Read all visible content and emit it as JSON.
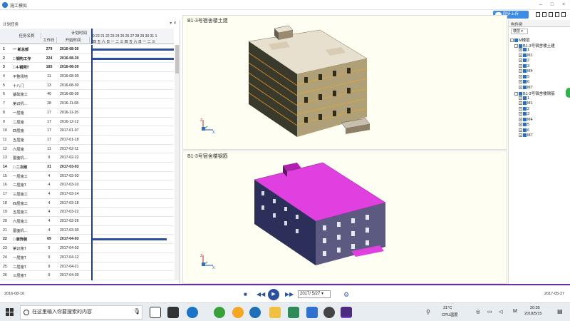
{
  "titlebar": {
    "title": "施工模拟"
  },
  "toolbar": {
    "cloud_label": "同步上传"
  },
  "plan_panel": {
    "title": "计划任务",
    "columns": {
      "name": "任务名称",
      "duration": "工作日",
      "start": "开始时间",
      "plan_group": "计划时间"
    },
    "gantt_days": "0 22 21 22 23 24 25 26 27 28 29 30 31 1",
    "gantt_weekdays": "四 五 六 日 一 二 三 四 五 六 日 一 二 三",
    "rows": [
      {
        "num": "1",
        "name": "一 新总部",
        "dur": "279",
        "date": "2016-08-30",
        "bold": true,
        "bar": 116
      },
      {
        "num": "2",
        "name": "□ 钢构工作",
        "dur": "224",
        "date": "2016-08-30",
        "bold": true,
        "bar": 116
      },
      {
        "num": "3",
        "name": "□ 4-钢网T",
        "dur": "185",
        "date": "2016-08-30",
        "bold": true,
        "bar": 0
      },
      {
        "num": "4",
        "name": "平整场地",
        "dur": "11",
        "date": "2016-08-30",
        "bold": false,
        "bar": 0
      },
      {
        "num": "5",
        "name": "十八门",
        "dur": "13",
        "date": "2016-08-30",
        "bold": false,
        "bar": 0
      },
      {
        "num": "6",
        "name": "基础施工",
        "dur": "40",
        "date": "2016-08-30",
        "bold": false,
        "bar": 0
      },
      {
        "num": "7",
        "name": "第识机…",
        "dur": "28",
        "date": "2016-11-08",
        "bold": false,
        "bar": 0
      },
      {
        "num": "8",
        "name": "一层施",
        "dur": "17",
        "date": "2016-11-25",
        "bold": false,
        "bar": 0
      },
      {
        "num": "9",
        "name": "二层施",
        "dur": "17",
        "date": "2016-12-12",
        "bold": false,
        "bar": 0
      },
      {
        "num": "10",
        "name": "四层施",
        "dur": "17",
        "date": "2017-01-07",
        "bold": false,
        "bar": 0
      },
      {
        "num": "11",
        "name": "五层施",
        "dur": "17",
        "date": "2017-01-18",
        "bold": false,
        "bar": 0
      },
      {
        "num": "12",
        "name": "六层施",
        "dur": "11",
        "date": "2017-02-11",
        "bold": false,
        "bar": 0
      },
      {
        "num": "13",
        "name": "屋面机…",
        "dur": "9",
        "date": "2017-02-22",
        "bold": false,
        "bar": 0
      },
      {
        "num": "14",
        "name": "□ 二次砌",
        "dur": "31",
        "date": "2017-03-03",
        "bold": true,
        "bar": 0
      },
      {
        "num": "15",
        "name": "一层施工",
        "dur": "4",
        "date": "2017-03-03",
        "bold": false,
        "bar": 0
      },
      {
        "num": "16",
        "name": "二层施T",
        "dur": "4",
        "date": "2017-03-10",
        "bold": false,
        "bar": 0
      },
      {
        "num": "17",
        "name": "三层施工",
        "dur": "4",
        "date": "2017-03-14",
        "bold": false,
        "bar": 0
      },
      {
        "num": "18",
        "name": "四层施工",
        "dur": "4",
        "date": "2017-03-18",
        "bold": false,
        "bar": 0
      },
      {
        "num": "19",
        "name": "五层施工",
        "dur": "4",
        "date": "2017-03-22",
        "bold": false,
        "bar": 0
      },
      {
        "num": "20",
        "name": "六层施工",
        "dur": "4",
        "date": "2017-03-26",
        "bold": false,
        "bar": 0
      },
      {
        "num": "21",
        "name": "屋面机…",
        "dur": "4",
        "date": "2017-03-30",
        "bold": false,
        "bar": 0
      },
      {
        "num": "22",
        "name": "□ 装饰装",
        "dur": "69",
        "date": "2017-04-03",
        "bold": true,
        "bar": 104
      },
      {
        "num": "23",
        "name": "第识施T",
        "dur": "9",
        "date": "2017-04-03",
        "bold": false,
        "bar": 0
      },
      {
        "num": "24",
        "name": "一层施T",
        "dur": "9",
        "date": "2017-04-12",
        "bold": false,
        "bar": 0
      },
      {
        "num": "25",
        "name": "二层施T",
        "dur": "9",
        "date": "2017-04-21",
        "bold": false,
        "bar": 0
      },
      {
        "num": "26",
        "name": "三层施T",
        "dur": "9",
        "date": "2017-04-30",
        "bold": false,
        "bar": 0
      }
    ]
  },
  "views": {
    "top_label": "B1-3号宿舍楼土建",
    "bottom_label": "B1-3号宿舍楼钢筋"
  },
  "right_panel": {
    "tab": "构件树",
    "sort_label": "楼层",
    "tree": [
      {
        "label": "M楼层",
        "level": 0,
        "exp": "-"
      },
      {
        "label": "B1-3号宿舍楼土建",
        "level": 1,
        "exp": "-"
      },
      {
        "label": "1",
        "level": 2,
        "exp": "+"
      },
      {
        "label": "M1",
        "level": 2,
        "exp": "+"
      },
      {
        "label": "2",
        "level": 2,
        "exp": "+"
      },
      {
        "label": "3",
        "level": 2,
        "exp": "+"
      },
      {
        "label": "M4",
        "level": 2,
        "exp": "+"
      },
      {
        "label": "5",
        "level": 2,
        "exp": "+"
      },
      {
        "label": "6",
        "level": 2,
        "exp": "+"
      },
      {
        "label": "M7",
        "level": 2,
        "exp": "+"
      },
      {
        "label": "B1-3号宿舍楼钢筋",
        "level": 1,
        "exp": "-"
      },
      {
        "label": "1",
        "level": 2,
        "exp": "+"
      },
      {
        "label": "M1",
        "level": 2,
        "exp": "+"
      },
      {
        "label": "2",
        "level": 2,
        "exp": "+"
      },
      {
        "label": "3",
        "level": 2,
        "exp": "+"
      },
      {
        "label": "M4",
        "level": 2,
        "exp": "+"
      },
      {
        "label": "5",
        "level": 2,
        "exp": "+"
      },
      {
        "label": "6",
        "level": 2,
        "exp": "+"
      },
      {
        "label": "M7",
        "level": 2,
        "exp": "+"
      }
    ]
  },
  "timeline": {
    "start_date": "2016-08-10",
    "end_date": "2017-05-27",
    "current_date": "2017/ 5/27"
  },
  "taskbar": {
    "search_placeholder": "在这里输入你要搜索的内容",
    "weather_temp": "31°C",
    "weather_desc": "CPU温度",
    "time": "20:35",
    "date": "2018/5/15",
    "lang": "M"
  }
}
